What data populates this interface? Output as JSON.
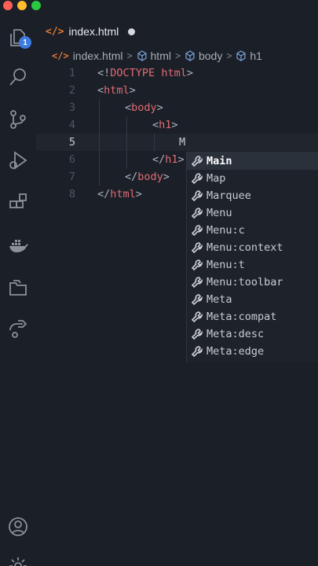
{
  "window": {
    "controls": [
      "close",
      "minimize",
      "maximize"
    ]
  },
  "activity_bar": {
    "items": [
      {
        "name": "explorer-icon",
        "badge": "1"
      },
      {
        "name": "search-icon"
      },
      {
        "name": "source-control-icon"
      },
      {
        "name": "run-debug-icon"
      },
      {
        "name": "extensions-icon"
      },
      {
        "name": "docker-icon"
      },
      {
        "name": "remote-explorer-icon"
      },
      {
        "name": "live-share-icon"
      },
      {
        "name": "account-icon"
      },
      {
        "name": "settings-gear-icon"
      }
    ]
  },
  "tab": {
    "glyph": "</>",
    "label": "index.html",
    "modified": true
  },
  "breadcrumb": {
    "glyph": "</>",
    "items": [
      "index.html",
      "html",
      "body",
      "h1"
    ],
    "separator": ">"
  },
  "editor": {
    "current_line": 5,
    "lines": [
      {
        "num": "1",
        "tokens": [
          {
            "t": "<!",
            "c": "punc"
          },
          {
            "t": "DOCTYPE",
            "c": "kw"
          },
          {
            "t": " ",
            "c": "text"
          },
          {
            "t": "html",
            "c": "kw"
          },
          {
            "t": ">",
            "c": "punc"
          }
        ]
      },
      {
        "num": "2",
        "tokens": [
          {
            "t": "<",
            "c": "punc"
          },
          {
            "t": "html",
            "c": "tag"
          },
          {
            "t": ">",
            "c": "punc"
          }
        ]
      },
      {
        "num": "3",
        "tokens": [
          {
            "t": "<",
            "c": "punc"
          },
          {
            "t": "body",
            "c": "tag"
          },
          {
            "t": ">",
            "c": "punc"
          }
        ]
      },
      {
        "num": "4",
        "tokens": [
          {
            "t": "<",
            "c": "punc"
          },
          {
            "t": "h1",
            "c": "tag"
          },
          {
            "t": ">",
            "c": "punc"
          }
        ]
      },
      {
        "num": "5",
        "tokens": [
          {
            "t": "M",
            "c": "text"
          }
        ]
      },
      {
        "num": "6",
        "tokens": [
          {
            "t": "</",
            "c": "punc"
          },
          {
            "t": "h1",
            "c": "tag"
          },
          {
            "t": ">",
            "c": "punc"
          }
        ]
      },
      {
        "num": "7",
        "tokens": [
          {
            "t": "</",
            "c": "punc"
          },
          {
            "t": "body",
            "c": "tag"
          },
          {
            "t": ">",
            "c": "punc"
          }
        ]
      },
      {
        "num": "8",
        "tokens": [
          {
            "t": "</",
            "c": "punc"
          },
          {
            "t": "html",
            "c": "tag"
          },
          {
            "t": ">",
            "c": "punc"
          }
        ]
      }
    ]
  },
  "suggestions": {
    "icon": "wrench-icon",
    "selected_index": 0,
    "items": [
      "Main",
      "Map",
      "Marquee",
      "Menu",
      "Menu:c",
      "Menu:context",
      "Menu:t",
      "Menu:toolbar",
      "Meta",
      "Meta:compat",
      "Meta:desc",
      "Meta:edge"
    ]
  },
  "colors": {
    "background": "#1b1f27",
    "keyword": "#e06c75",
    "punctuation": "#abb2bf",
    "html_glyph": "#e37933",
    "badge": "#3d7be0"
  }
}
